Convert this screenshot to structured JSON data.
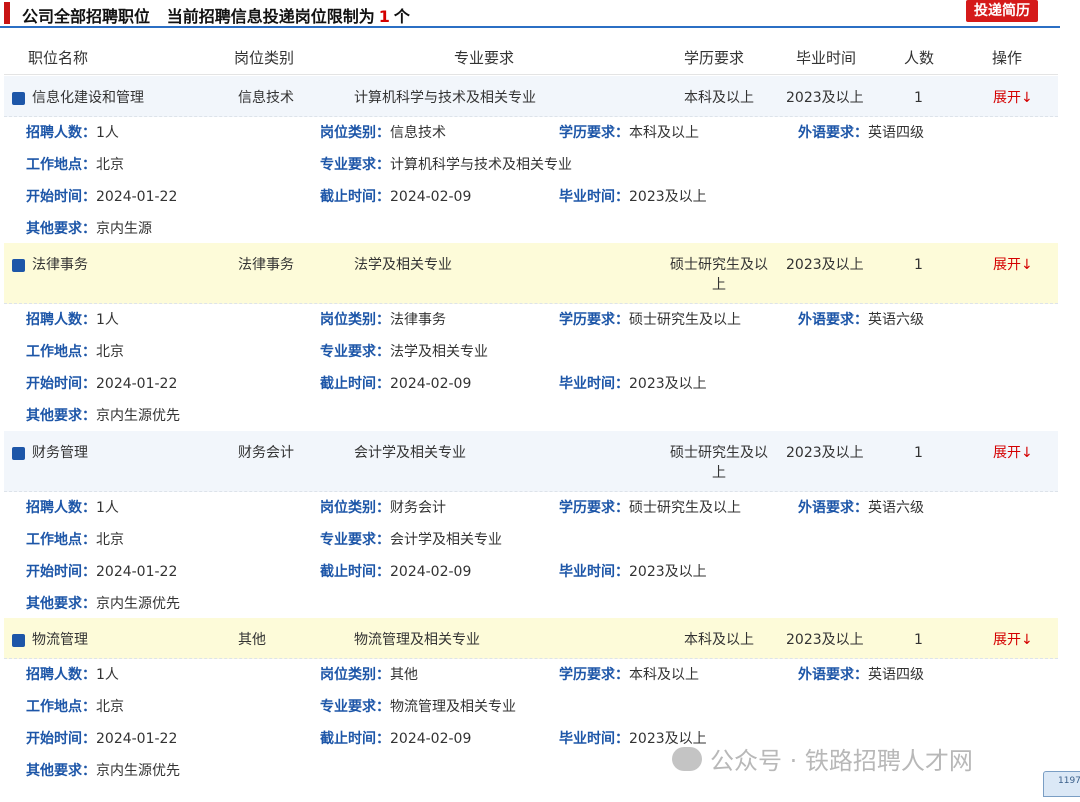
{
  "header": {
    "title_prefix": "公司全部招聘职位",
    "title_limit_text": "当前招聘信息投递岗位限制为",
    "limit": "1",
    "limit_unit": "个",
    "apply_label": "投递简历"
  },
  "columns": [
    "职位名称",
    "岗位类别",
    "专业要求",
    "学历要求",
    "毕业时间",
    "人数",
    "操作"
  ],
  "detail_labels": {
    "count": "招聘人数：",
    "category": "岗位类别：",
    "education": "学历要求：",
    "language": "外语要求：",
    "location": "工作地点：",
    "major": "专业要求：",
    "start": "开始时间：",
    "end": "截止时间：",
    "grad": "毕业时间：",
    "other": "其他要求："
  },
  "jobs": [
    {
      "name": "信息化建设和管理",
      "category": "信息技术",
      "major": "计算机科学与技术及相关专业",
      "education": "本科及以上",
      "grad": "2023及以上",
      "count": "1",
      "action": "展开↓",
      "detail": {
        "count": "1人",
        "category": "信息技术",
        "education": "本科及以上",
        "language": "英语四级",
        "location": "北京",
        "major": "计算机科学与技术及相关专业",
        "start": "2024-01-22",
        "end": "2024-02-09",
        "grad": "2023及以上",
        "other": "京内生源"
      }
    },
    {
      "name": "法律事务",
      "category": "法律事务",
      "major": "法学及相关专业",
      "education": "硕士研究生及以上",
      "grad": "2023及以上",
      "count": "1",
      "action": "展开↓",
      "detail": {
        "count": "1人",
        "category": "法律事务",
        "education": "硕士研究生及以上",
        "language": "英语六级",
        "location": "北京",
        "major": "法学及相关专业",
        "start": "2024-01-22",
        "end": "2024-02-09",
        "grad": "2023及以上",
        "other": "京内生源优先"
      }
    },
    {
      "name": "财务管理",
      "category": "财务会计",
      "major": "会计学及相关专业",
      "education": "硕士研究生及以上",
      "grad": "2023及以上",
      "count": "1",
      "action": "展开↓",
      "detail": {
        "count": "1人",
        "category": "财务会计",
        "education": "硕士研究生及以上",
        "language": "英语六级",
        "location": "北京",
        "major": "会计学及相关专业",
        "start": "2024-01-22",
        "end": "2024-02-09",
        "grad": "2023及以上",
        "other": "京内生源优先"
      }
    },
    {
      "name": "物流管理",
      "category": "其他",
      "major": "物流管理及相关专业",
      "education": "本科及以上",
      "grad": "2023及以上",
      "count": "1",
      "action": "展开↓",
      "detail": {
        "count": "1人",
        "category": "其他",
        "education": "本科及以上",
        "language": "英语四级",
        "location": "北京",
        "major": "物流管理及相关专业",
        "start": "2024-01-22",
        "end": "2024-02-09",
        "grad": "2023及以上",
        "other": "京内生源优先"
      }
    }
  ],
  "watermark": "公众号 · 铁路招聘人才网",
  "corner_text": "1197"
}
